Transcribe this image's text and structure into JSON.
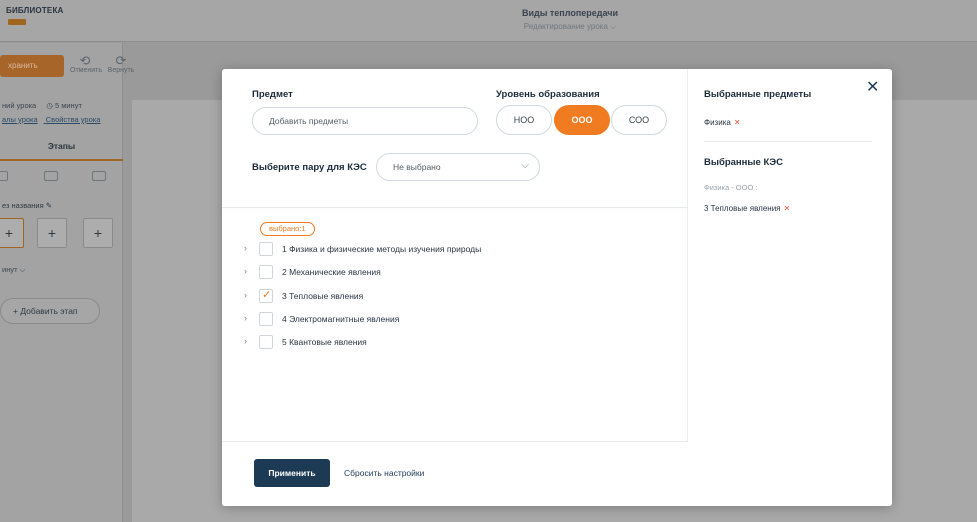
{
  "app": {
    "logo": "БИБЛИОТЕКА",
    "title": "Виды теплопередачи",
    "subtitle": "Редактирование урока ⌵"
  },
  "sidebar": {
    "save_label": "хранить",
    "undo_label": "Отменить",
    "redo_label": "Вернуть",
    "lesson_scenario": "ний урока",
    "duration": "◷ 5 минут",
    "link_materials": "алы урока",
    "link_properties": "Свойства урока",
    "stages_tab": "Этапы",
    "untitled_stage": "ез названия ✎",
    "minutes": "инут ⌵",
    "add_stage": "+ Добавить этап"
  },
  "modal": {
    "subject_label": "Предмет",
    "subject_placeholder": "Добавить предметы",
    "level_label": "Уровень образования",
    "levels": [
      {
        "label": "НОО",
        "active": false
      },
      {
        "label": "ООО",
        "active": true
      },
      {
        "label": "СОО",
        "active": false
      }
    ],
    "pair_label": "Выберите пару для КЭС",
    "pair_value": "Не выбрано",
    "selected_badge": "выбрано:1",
    "tree": [
      {
        "label": "1 Физика и физические методы изучения природы",
        "checked": false
      },
      {
        "label": "2 Механические явления",
        "checked": false
      },
      {
        "label": "3 Тепловые явления",
        "checked": true
      },
      {
        "label": "4 Электромагнитные явления",
        "checked": false
      },
      {
        "label": "5 Квантовые явления",
        "checked": false
      }
    ],
    "apply_label": "Применить",
    "reset_label": "Сбросить настройки",
    "close_icon": "✕"
  },
  "summary": {
    "subjects_heading": "Выбранные предметы",
    "subject_chip": "Физика",
    "kes_heading": "Выбранные КЭС",
    "kes_group": "Физика - ООО :",
    "kes_chip": "3 Тепловые явления",
    "remove_symbol": "✕"
  },
  "colors": {
    "accent": "#f07b21",
    "primary": "#1d3a55",
    "remove": "#e8553f"
  }
}
